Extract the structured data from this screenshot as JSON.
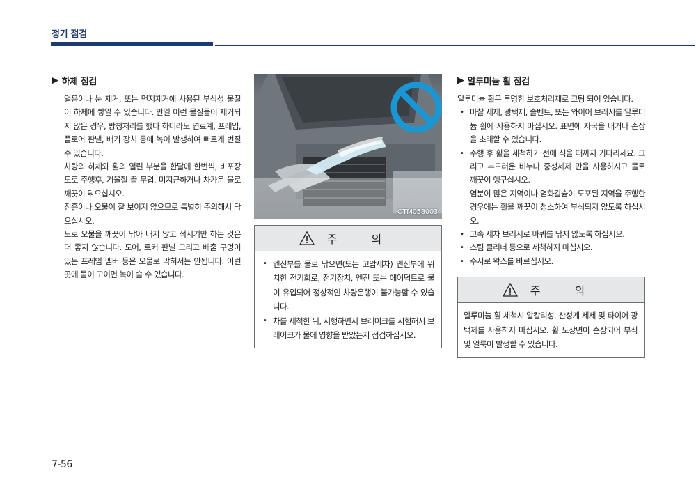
{
  "header": {
    "title": "정기 점검"
  },
  "left": {
    "heading": "하체 점검",
    "paragraphs": [
      "얼음이나 눈 제거, 또는 먼지제거에 사용된 부식성 물질이 하체에 쌓일 수 있습니다.  만일 이런 물질들이 제거되지 않은 경우, 방청처리를 했다 하더라도 연료계, 프레임, 플로어 판넬, 배기 장치 등에 녹이 발생하여 빠르게 번질 수 있습니다.",
      "차량의 하체와 휠의 열린 부분을 한달에 한번씩, 비포장 도로 주행후, 겨울철 끝 무렵, 미지근하거나 차가운 물로 깨끗이 닦으십시오.",
      "진흙이나 오물이 잘 보이지 않으므로 특별히 주의해서 닦으십시오.",
      "도로 오물을 깨끗이 닦아 내지 않고 적시기만 하는 것은 더 좋지 않습니다. 도어, 로커 판넬 그리고 배출 구멍이 있는 프레임 멤버 등은 오물로 막혀서는 안됩니다. 이런 곳에 물이 고이면 녹이 슬 수 있습니다."
    ]
  },
  "middle": {
    "photo_code": "OTM058003",
    "caution_label": "주 의",
    "caution_items": [
      "엔진부를 물로 닦으면(또는 고압세차) 엔진부에 위치한 전기회로, 전기장치, 엔진 또는 에어덕트로 물이 유입되어 정상적인 차량운행이 불가능할 수 있습니다.",
      "차를 세척한 뒤, 서행하면서 브레이크를 시험해서 브레이크가 물에 영향을 받았는지 점검하십시오."
    ]
  },
  "right": {
    "heading": "알루미늄 휠 점검",
    "intro": "알루미늄 휠은 투명한 보호처리제로 코팅 되어 있습니다.",
    "items": [
      "마찰 세제, 광택제, 솔벤트, 또는 와이어 브러시를 알루미늄 휠에 사용하지 마십시오. 표면에 자국을 내거나 손상을 초래할 수 있습니다.",
      "주행 후 휠을 세척하기 전에 식을 때까지 기다리세요. 그리고 부드러운 비누나 중성세제 만을 사용하시고 물로 깨끗이 헹구십시오.",
      "고속 세차 브러시로 바퀴를 닦지 않도록 하십시오.",
      "스팀 클리너 등으로 세척하지 마십시오.",
      "수시로 왁스를 바르십시오."
    ],
    "item2_extra": "염분이 많은 지역이나 염화칼슘이 도포된 지역을 주행한 경우에는 휠을 깨끗이 청소하여 부식되지 않도록 하십시오.",
    "caution_label": "주 의",
    "caution_text": "알루미늄 휠 세척시 알칼리성, 산성계 세제 및 타이어 광택제를 사용하지 마십시오. 휠 도장면이 손상되어 부식 및 얼룩이 발생할 수 있습니다."
  },
  "page_number": "7-56"
}
